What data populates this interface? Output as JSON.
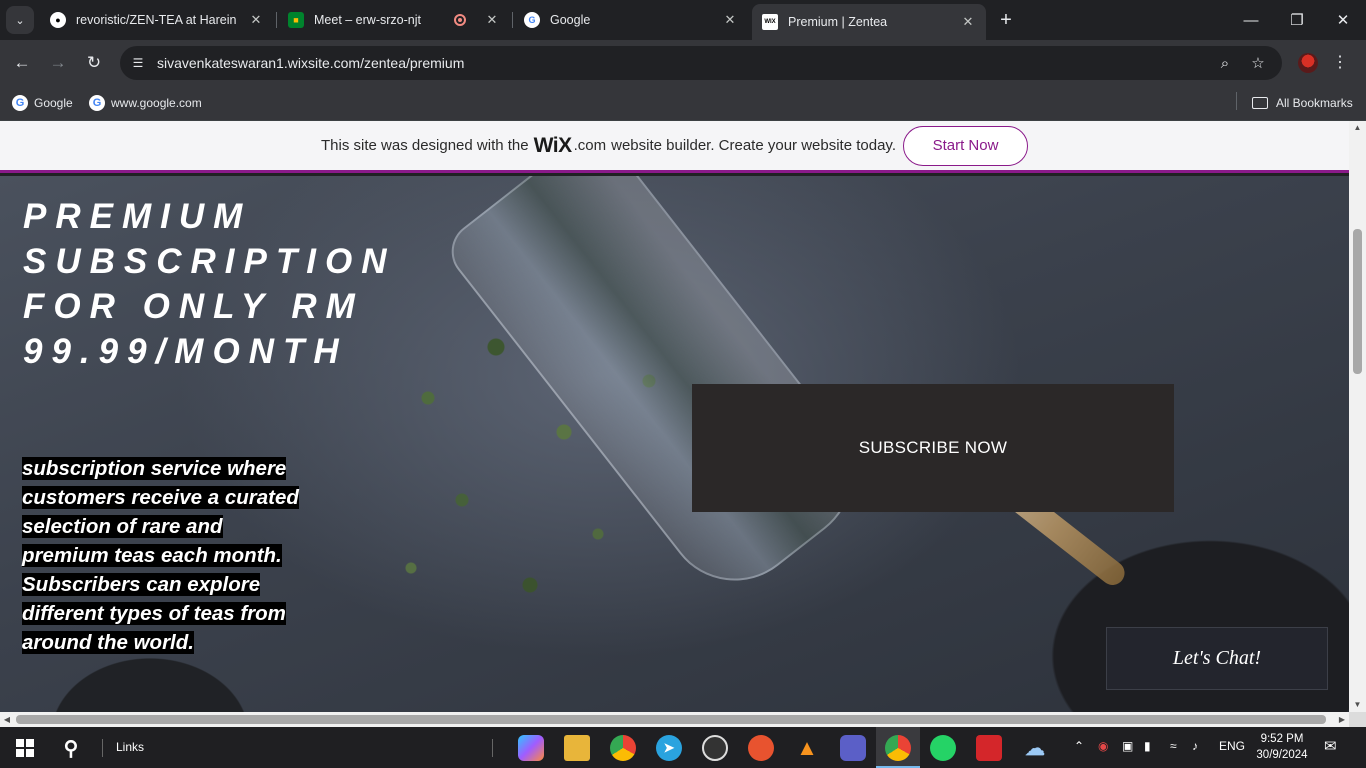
{
  "browser": {
    "tabs": [
      {
        "title": "revoristic/ZEN-TEA at Harein",
        "icon": "github-icon"
      },
      {
        "title": "Meet – erw-srzo-njt",
        "icon": "meet-icon",
        "recording": true
      },
      {
        "title": "Google",
        "icon": "google-icon"
      },
      {
        "title": "Premium | Zentea",
        "icon": "wix-icon",
        "active": true
      }
    ],
    "url": "sivavenkateswaran1.wixsite.com/zentea/premium",
    "bookmarks": [
      {
        "label": "Google"
      },
      {
        "label": "www.google.com"
      }
    ],
    "all_bookmarks": "All Bookmarks"
  },
  "wix_banner": {
    "text_before": "This site was designed with the",
    "logo": "WiX",
    "logo_suffix": ".com",
    "text_after": "website builder. Create your website today.",
    "button": "Start Now",
    "accent": "#8a1a8a"
  },
  "page": {
    "headline": "PREMIUM\nSUBSCRIPTION\nFOR ONLY RM\n99.99/MONTH",
    "description_lines": [
      "subscription service where",
      "customers receive a curated",
      "selection of rare and",
      "premium teas each month.",
      "Subscribers can explore",
      "different types of teas from",
      "around the world."
    ],
    "subscribe_button": "SUBSCRIBE NOW",
    "chat_button": "Let's Chat!"
  },
  "taskbar": {
    "links": "Links",
    "language": "ENG",
    "time": "9:52 PM",
    "date": "30/9/2024"
  }
}
